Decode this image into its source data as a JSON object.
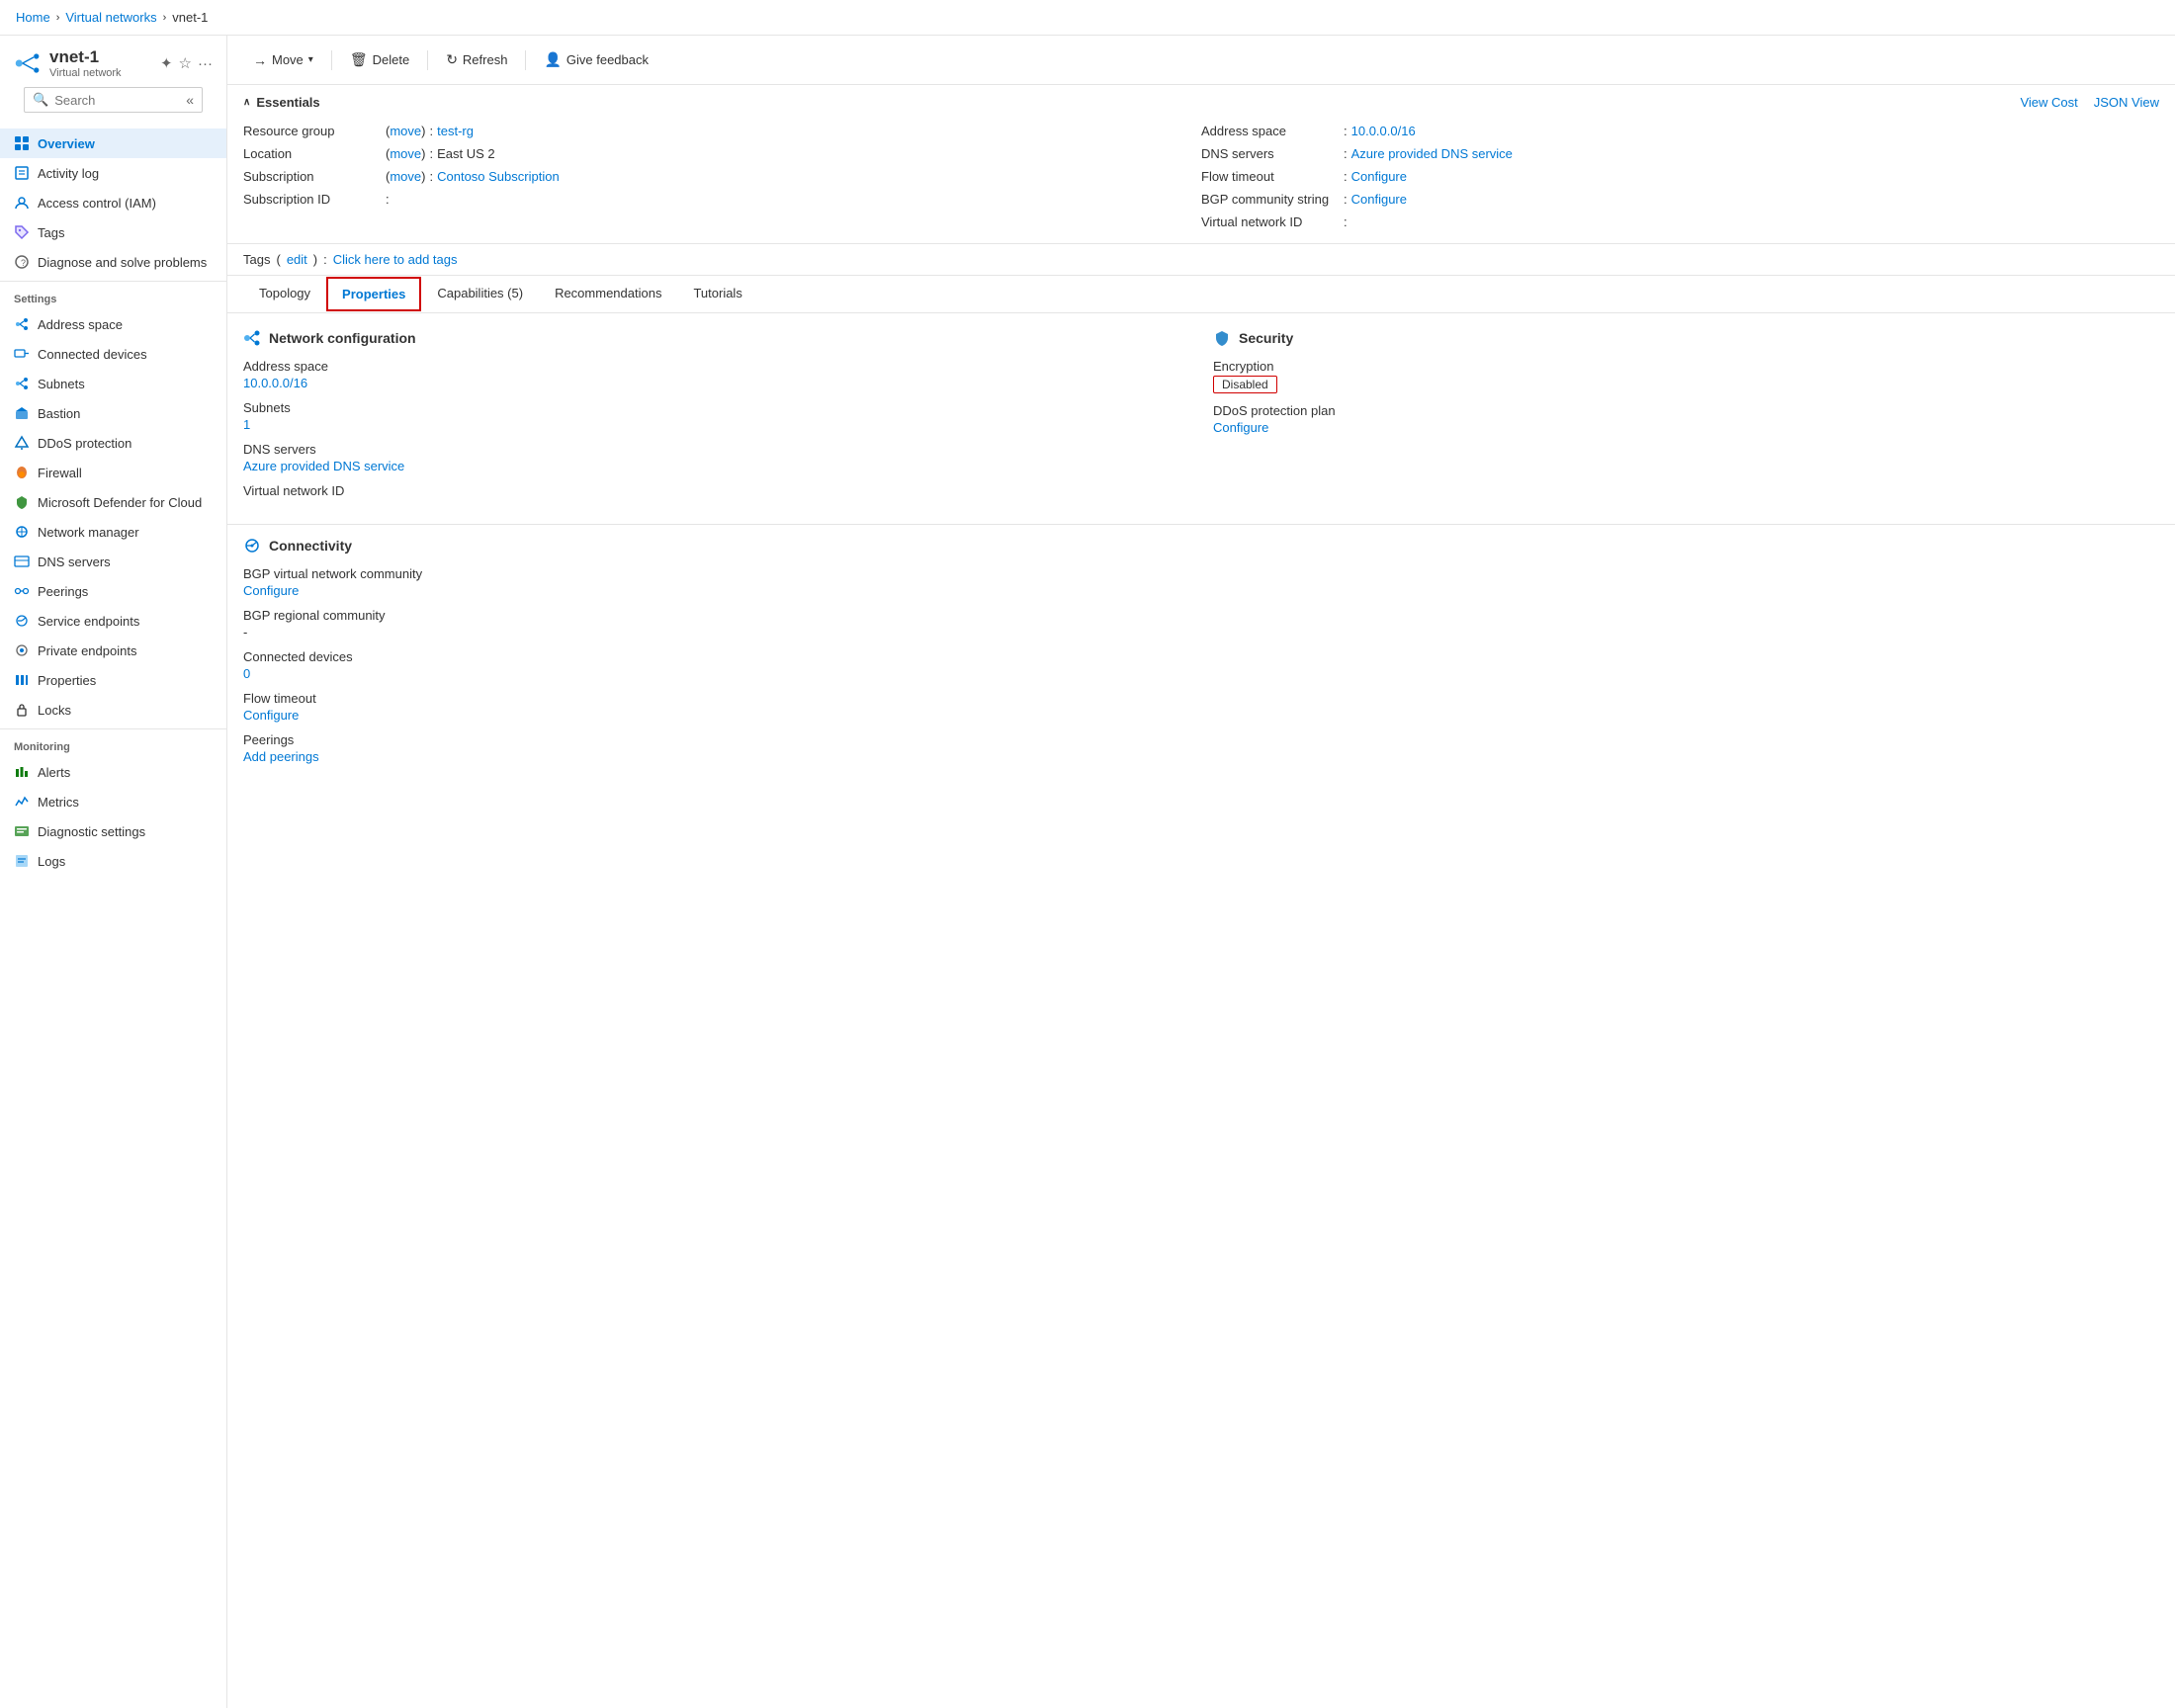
{
  "breadcrumb": {
    "home": "Home",
    "virtualNetworks": "Virtual networks",
    "current": "vnet-1"
  },
  "sidebar": {
    "resourceName": "vnet-1",
    "resourceType": "Virtual network",
    "search": {
      "placeholder": "Search"
    },
    "overview": "Overview",
    "navItems": [
      {
        "id": "overview",
        "label": "Overview",
        "active": true
      },
      {
        "id": "activity-log",
        "label": "Activity log",
        "active": false
      },
      {
        "id": "access-control",
        "label": "Access control (IAM)",
        "active": false
      },
      {
        "id": "tags",
        "label": "Tags",
        "active": false
      },
      {
        "id": "diagnose",
        "label": "Diagnose and solve problems",
        "active": false
      }
    ],
    "settingsLabel": "Settings",
    "settingsItems": [
      {
        "id": "address-space",
        "label": "Address space"
      },
      {
        "id": "connected-devices",
        "label": "Connected devices"
      },
      {
        "id": "subnets",
        "label": "Subnets"
      },
      {
        "id": "bastion",
        "label": "Bastion"
      },
      {
        "id": "ddos-protection",
        "label": "DDoS protection"
      },
      {
        "id": "firewall",
        "label": "Firewall"
      },
      {
        "id": "defender",
        "label": "Microsoft Defender for Cloud"
      },
      {
        "id": "network-manager",
        "label": "Network manager"
      },
      {
        "id": "dns-servers",
        "label": "DNS servers"
      },
      {
        "id": "peerings",
        "label": "Peerings"
      },
      {
        "id": "service-endpoints",
        "label": "Service endpoints"
      },
      {
        "id": "private-endpoints",
        "label": "Private endpoints"
      },
      {
        "id": "properties",
        "label": "Properties"
      },
      {
        "id": "locks",
        "label": "Locks"
      }
    ],
    "monitoringLabel": "Monitoring",
    "monitoringItems": [
      {
        "id": "alerts",
        "label": "Alerts"
      },
      {
        "id": "metrics",
        "label": "Metrics"
      },
      {
        "id": "diagnostic-settings",
        "label": "Diagnostic settings"
      },
      {
        "id": "logs",
        "label": "Logs"
      }
    ]
  },
  "toolbar": {
    "moveLabel": "Move",
    "deleteLabel": "Delete",
    "refreshLabel": "Refresh",
    "giveFeedbackLabel": "Give feedback"
  },
  "essentials": {
    "title": "Essentials",
    "viewCostLabel": "View Cost",
    "jsonViewLabel": "JSON View",
    "resourceGroupLabel": "Resource group",
    "resourceGroupMoveLabel": "move",
    "resourceGroupValue": "test-rg",
    "locationLabel": "Location",
    "locationMoveLabel": "move",
    "locationValue": "East US 2",
    "subscriptionLabel": "Subscription",
    "subscriptionMoveLabel": "move",
    "subscriptionValue": "Contoso Subscription",
    "subscriptionIdLabel": "Subscription ID",
    "subscriptionIdValue": "",
    "addressSpaceLabel": "Address space",
    "addressSpaceValue": "10.0.0.0/16",
    "dnsServersLabel": "DNS servers",
    "dnsServersValue": "Azure provided DNS service",
    "flowTimeoutLabel": "Flow timeout",
    "flowTimeoutValue": "Configure",
    "bgpCommunityLabel": "BGP community string",
    "bgpCommunityValue": "Configure",
    "virtualNetworkIdLabel": "Virtual network ID",
    "virtualNetworkIdValue": ""
  },
  "tags": {
    "label": "Tags",
    "editLabel": "edit",
    "addTagsLabel": "Click here to add tags"
  },
  "tabs": [
    {
      "id": "topology",
      "label": "Topology",
      "active": false
    },
    {
      "id": "properties",
      "label": "Properties",
      "active": true
    },
    {
      "id": "capabilities",
      "label": "Capabilities (5)",
      "active": false
    },
    {
      "id": "recommendations",
      "label": "Recommendations",
      "active": false
    },
    {
      "id": "tutorials",
      "label": "Tutorials",
      "active": false
    }
  ],
  "networkConfig": {
    "sectionTitle": "Network configuration",
    "addressSpaceLabel": "Address space",
    "addressSpaceValue": "10.0.0.0/16",
    "subnetsLabel": "Subnets",
    "subnetsValue": "1",
    "dnsServersLabel": "DNS servers",
    "dnsServersValue": "Azure provided DNS service",
    "virtualNetworkIdLabel": "Virtual network ID",
    "virtualNetworkIdValue": ""
  },
  "security": {
    "sectionTitle": "Security",
    "encryptionLabel": "Encryption",
    "encryptionValue": "Disabled",
    "ddosProtectionLabel": "DDoS protection plan",
    "ddosConfigureLabel": "Configure"
  },
  "connectivity": {
    "sectionTitle": "Connectivity",
    "bgpVnetLabel": "BGP virtual network community",
    "bgpVnetConfigureLabel": "Configure",
    "bgpRegionalLabel": "BGP regional community",
    "bgpRegionalValue": "-",
    "connectedDevicesLabel": "Connected devices",
    "connectedDevicesValue": "0",
    "flowTimeoutLabel": "Flow timeout",
    "flowTimeoutConfigureLabel": "Configure",
    "peeringsLabel": "Peerings",
    "peeringsConfigureLabel": "Add peerings"
  }
}
